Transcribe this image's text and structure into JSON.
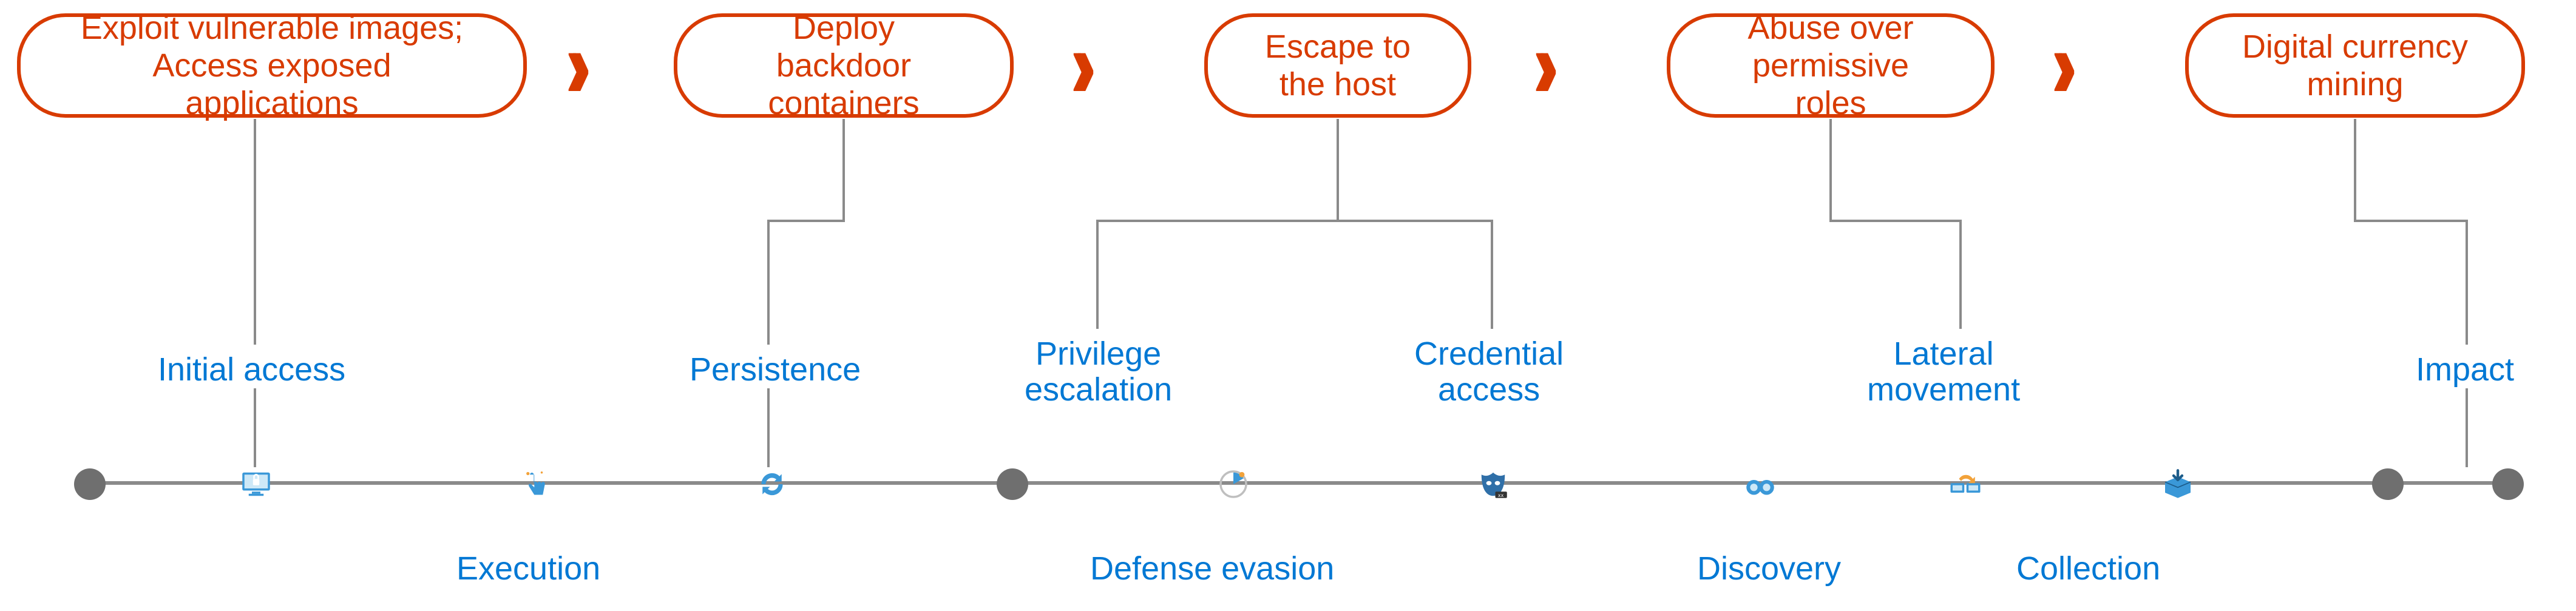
{
  "pills": [
    {
      "id": "p1",
      "text": "Exploit vulnerable images;\nAccess exposed applications"
    },
    {
      "id": "p2",
      "text": "Deploy backdoor\ncontainers"
    },
    {
      "id": "p3",
      "text": "Escape to\nthe host"
    },
    {
      "id": "p4",
      "text": "Abuse over\npermissive roles"
    },
    {
      "id": "p5",
      "text": "Digital currency\nmining"
    }
  ],
  "stages": {
    "initial_access": "Initial access",
    "execution": "Execution",
    "persistence": "Persistence",
    "privilege_escalation": "Privilege\nescalation",
    "defense_evasion": "Defense evasion",
    "credential_access": "Credential\naccess",
    "discovery": "Discovery",
    "lateral_movement": "Lateral\nmovement",
    "collection": "Collection",
    "impact": "Impact"
  },
  "colors": {
    "orange": "#d83b01",
    "blue": "#0078d4",
    "gray": "#8a8a8a"
  },
  "timeline_order": [
    "start_dot",
    "initial_access",
    "execution",
    "persistence",
    "mid_dot",
    "defense_evasion",
    "privilege_escalation_anchor",
    "credential_access",
    "discovery",
    "lateral_movement",
    "collection",
    "end_dot1",
    "end_dot2"
  ]
}
